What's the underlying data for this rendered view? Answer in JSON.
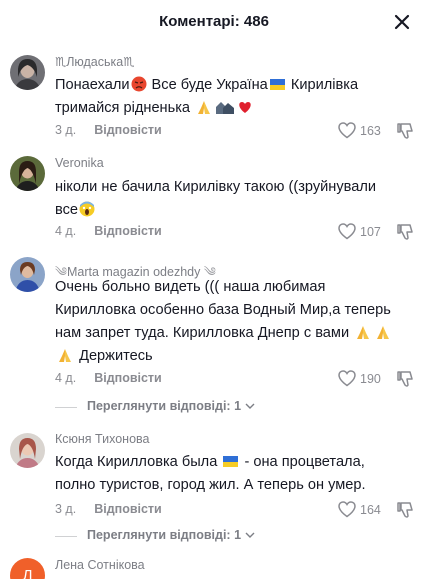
{
  "header": {
    "title": "Коментарі: 486"
  },
  "comments": [
    {
      "username": "♏Людаська♏",
      "text_1": "Понаехали",
      "text_2": " Все буде Україна",
      "text_3": " Кирилівка",
      "text_4": "тримайся рідненька",
      "age": "3 д.",
      "reply_label": "Відповісти",
      "likes": "163"
    },
    {
      "username": "Veronika",
      "text_1": "ніколи не бачила Кирилівку такою ((зруйнували",
      "text_2": "все",
      "age": "4 д.",
      "reply_label": "Відповісти",
      "likes": "107"
    },
    {
      "username": "Marta magazin odezhdy",
      "text_1": "Очень больно видеть ((( наша любимая",
      "text_2": "Кирилловка особенно база Водный Мир,а теперь",
      "text_3": "нам запрет туда. Кирилловка Днепр с вами",
      "text_4": "Держитесь",
      "age": "4 д.",
      "reply_label": "Відповісти",
      "likes": "190",
      "view_replies": "Переглянути відповіді: 1"
    },
    {
      "username": "Ксюня Тихонова",
      "text_1": "Когда Кирилловка была",
      "text_2": " - она процветала,",
      "text_3": "полно туристов, город жил. А теперь он умер.",
      "age": "3 д.",
      "reply_label": "Відповісти",
      "likes": "164",
      "view_replies": "Переглянути відповіді: 1"
    },
    {
      "username": "Лена Сотнікова",
      "avatar_letter": "Л"
    }
  ],
  "colors": {
    "text": "#161823",
    "muted": "#8a8b91",
    "ukraine_blue": "#2f6fd6",
    "ukraine_yellow": "#f6cc25",
    "avatar_orange": "#f0602a"
  }
}
